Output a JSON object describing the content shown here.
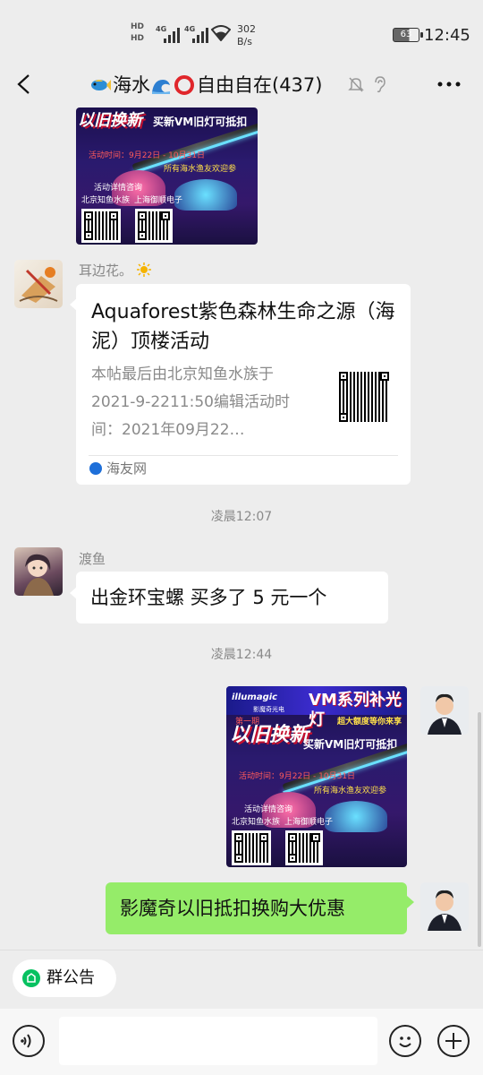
{
  "status_bar": {
    "net_top": "HD",
    "net_bottom": "HD",
    "sig1_gen": "4G",
    "sig2_gen": "4G",
    "speed_value": "302",
    "speed_unit": "B/s",
    "battery": "63",
    "time": "12:45"
  },
  "header": {
    "title_prefix_1": "海水",
    "title_main": "自由自在(437)",
    "icons": [
      "back-icon",
      "fish-emoji-icon",
      "wave-emoji-icon",
      "circle-emoji-icon",
      "mute-bell-icon",
      "ear-icon",
      "more-icon"
    ]
  },
  "promo_image": {
    "logo": "illumagic",
    "logo_sub": "影魔奇光电",
    "series": "VM系列补光灯",
    "tagline": "超大额度等你来享",
    "big": "以旧换新",
    "ribbon": "第一期",
    "offer": "买新VM旧灯可抵扣",
    "time_line": "活动时间：9月22日 - 10月31日",
    "scope": "所有海水渔友欢迎参",
    "consult": "活动详情咨询",
    "partner_1": "北京知鱼水族",
    "partner_2": "上海御顺电子"
  },
  "messages": {
    "sender_1": "耳边花。",
    "link_card": {
      "title": "Aquaforest紫色森林生命之源（海泥）顶楼活动",
      "description": "本帖最后由北京知鱼水族于2021-9-2211:50编辑活动时间：2021年09月22…",
      "source": "海友网"
    },
    "time_1": "凌晨12:07",
    "sender_2": "渡鱼",
    "text_2": "出金环宝螺  买多了 5 元一个",
    "time_2": "凌晨12:44",
    "text_self": "影魔奇以旧抵扣换购大优惠"
  },
  "bottom": {
    "notice_label": "群公告",
    "input_placeholder": "",
    "icons": [
      "voice-icon",
      "emoji-icon",
      "plus-icon"
    ]
  }
}
